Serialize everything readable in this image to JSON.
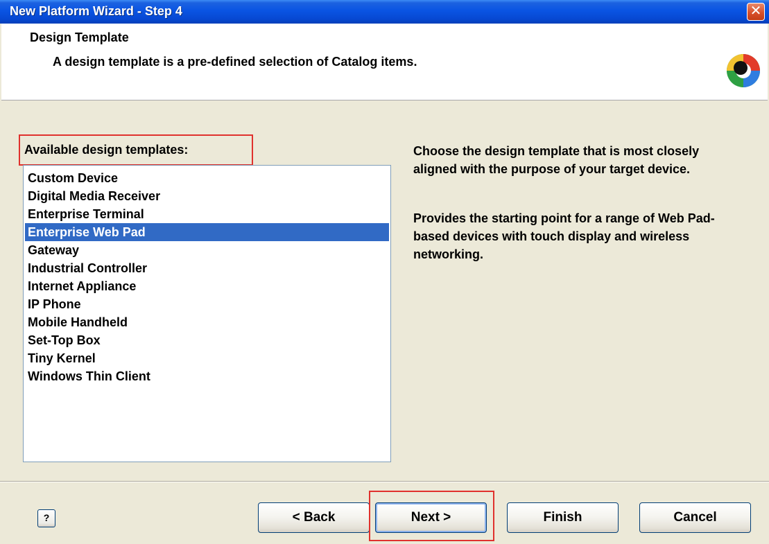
{
  "window": {
    "title": "New Platform Wizard - Step 4",
    "close_glyph": "✕"
  },
  "header": {
    "title": "Design Template",
    "subtitle": "A design template is a pre-defined selection of Catalog items.",
    "logo_icon": "wizard-logo-icon"
  },
  "templates": {
    "label": "Available design templates:",
    "selected": "Enterprise Web Pad",
    "items": [
      "Custom Device",
      "Digital Media Receiver",
      "Enterprise Terminal",
      "Enterprise Web Pad",
      "Gateway",
      "Industrial Controller",
      "Internet Appliance",
      "IP Phone",
      "Mobile Handheld",
      "Set-Top Box",
      "Tiny Kernel",
      "Windows Thin Client"
    ]
  },
  "description": {
    "intro": "Choose the design template that is most closely aligned with the purpose of your target device.",
    "detail": "Provides the starting point for a range of Web Pad-based devices with touch display and wireless networking."
  },
  "buttons": {
    "help": "?",
    "back": "< Back",
    "next": "Next >",
    "finish": "Finish",
    "cancel": "Cancel"
  },
  "colors": {
    "titlebar": "#0a54e3",
    "selection": "#316ac5",
    "highlight": "#e0312d",
    "dialog_bg": "#ece9d8"
  }
}
